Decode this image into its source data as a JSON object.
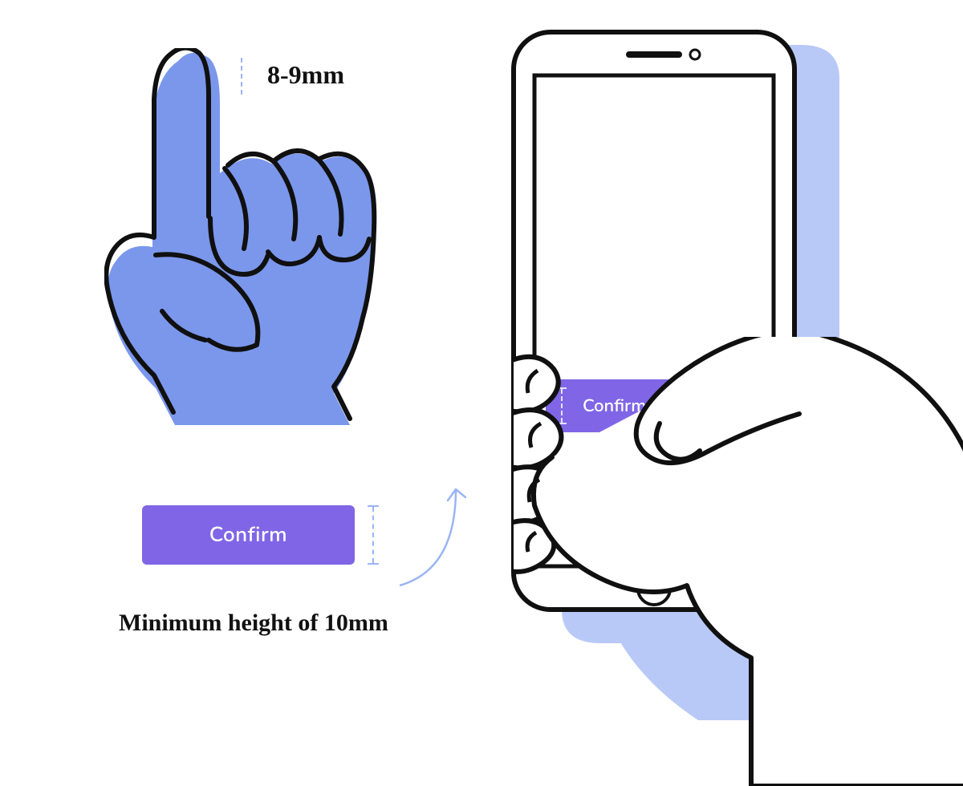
{
  "fingertip": {
    "width_label": "8-9mm"
  },
  "button": {
    "label": "Confirm",
    "min_height_label": "Minimum height of 10mm"
  },
  "phone_button": {
    "label": "Confirm"
  },
  "colors": {
    "accent": "#8066E6",
    "fill": "#7B97EC",
    "shadow": "#B9C9F7",
    "measure": "#9BB4F6"
  }
}
